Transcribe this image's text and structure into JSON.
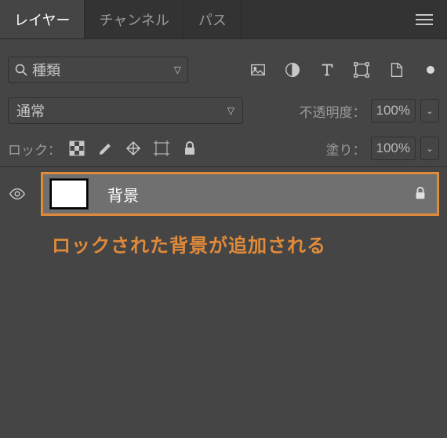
{
  "tabs": {
    "layers": "レイヤー",
    "channels": "チャンネル",
    "paths": "パス"
  },
  "search": {
    "placeholder": "種類"
  },
  "blend": {
    "mode": "通常",
    "opacity_label": "不透明度：",
    "opacity_value": "100%"
  },
  "lock": {
    "label": "ロック：",
    "fill_label": "塗り：",
    "fill_value": "100%"
  },
  "layer": {
    "name": "背景"
  },
  "annotation": "ロックされた背景が追加される"
}
